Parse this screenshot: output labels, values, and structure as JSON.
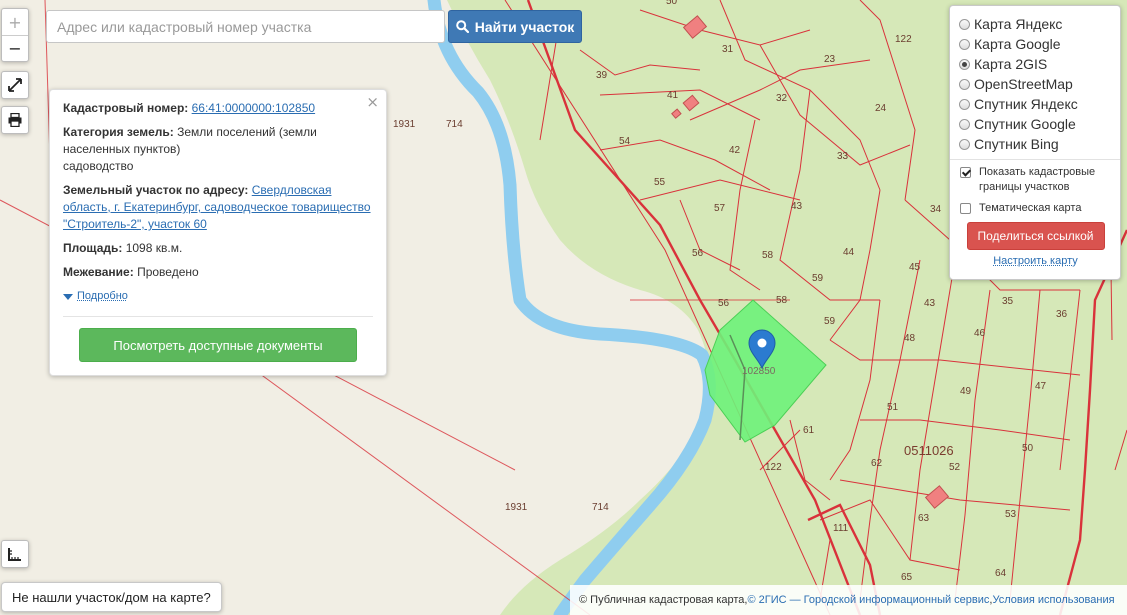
{
  "search": {
    "placeholder": "Адрес или кадастровый номер участка",
    "button_label": "Найти участок"
  },
  "zoom": {
    "in_label": "+",
    "out_label": "−"
  },
  "info_panel": {
    "cadastral_label": "Кадастровый номер:",
    "cadastral_value": "66:41:0000000:102850",
    "category_label": "Категория земель:",
    "category_value_line1": "Земли поселений (земли",
    "category_value_line2": "населенных пунктов)",
    "category_value_line3": "садоводство",
    "address_label": "Земельный участок по адресу:",
    "address_value": "Свердловская область, г. Екатеринбург, садоводческое товарищество \"Строитель-2\", участок 60",
    "area_label": "Площадь:",
    "area_value": "1098 кв.м.",
    "survey_label": "Межевание:",
    "survey_value": "Проведено",
    "more_label": "Подробно",
    "docs_button": "Посмотреть доступные документы",
    "close_glyph": "×"
  },
  "layers": {
    "options": [
      {
        "label": "Карта Яндекс",
        "selected": false
      },
      {
        "label": "Карта Google",
        "selected": false
      },
      {
        "label": "Карта 2GIS",
        "selected": true
      },
      {
        "label": "OpenStreetMap",
        "selected": false
      },
      {
        "label": "Спутник Яндекс",
        "selected": false
      },
      {
        "label": "Спутник Google",
        "selected": false
      },
      {
        "label": "Спутник Bing",
        "selected": false
      }
    ],
    "show_borders_label": "Показать кадастровые границы участков",
    "show_borders_checked": true,
    "thematic_label": "Тематическая карта",
    "thematic_checked": false,
    "share_button": "Поделиться ссылкой",
    "configure_link": "Настроить карту"
  },
  "not_found_button": "Не нашли участок/дом на карте?",
  "attribution": {
    "prefix": "© Публичная кадастровая карта, ",
    "link": "© 2ГИС — Городской информационный сервис",
    "separator": ", ",
    "terms": "Условия использования"
  },
  "map": {
    "colors": {
      "background": "#f1eee4",
      "settlement": "#d6e8b8",
      "river": "#8fcdef",
      "parcel_border": "#d9323b",
      "selected_parcel": "#6ef27a",
      "building": "#f08080",
      "marker": "#2b7bd0"
    },
    "marker_icon": "map-pin-icon",
    "selected_parcel_label": "102850",
    "quarter_label": "0511026",
    "parcel_labels": [
      "50",
      "31",
      "23",
      "122",
      "39",
      "32",
      "24",
      "41",
      "54",
      "42",
      "33",
      "55",
      "57",
      "43",
      "34",
      "56",
      "58",
      "44",
      "45",
      "59",
      "58",
      "43",
      "35",
      "56",
      "59",
      "48",
      "46",
      "36",
      "49",
      "47",
      "51",
      "61",
      "50",
      "62",
      "52",
      "122",
      "111",
      "63",
      "53",
      "65",
      "64",
      "1931",
      "714",
      "1931",
      "714"
    ]
  }
}
